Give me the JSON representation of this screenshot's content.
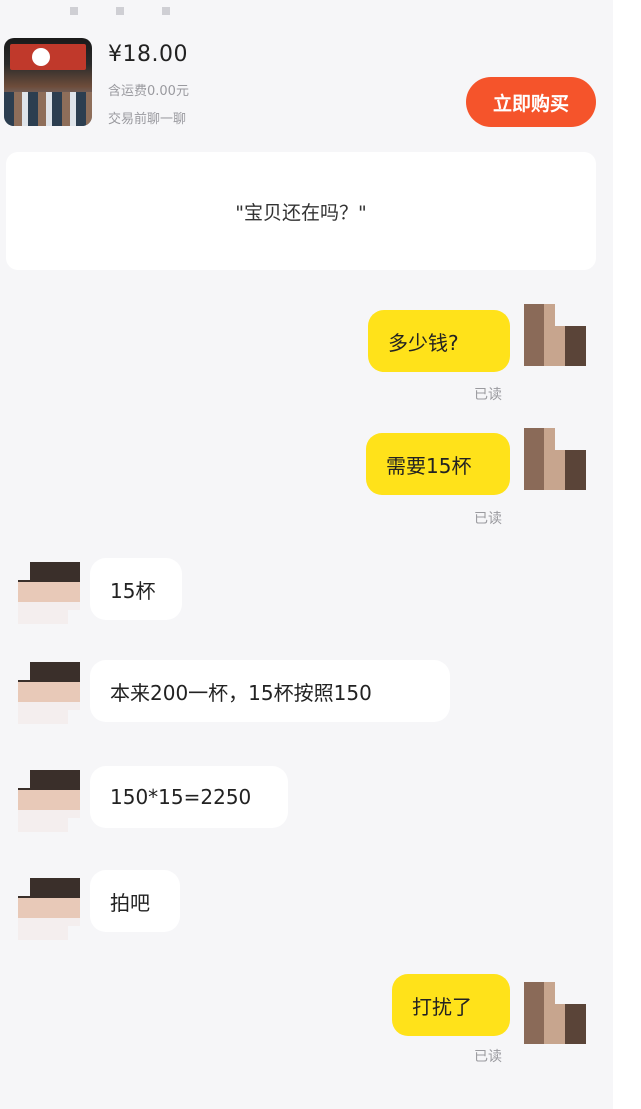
{
  "product": {
    "price": "¥18.00",
    "shipping": "含运费0.00元",
    "note": "交易前聊一聊",
    "buy_button": "立即购买"
  },
  "quote": "\"宝贝还在吗？\"",
  "messages": [
    {
      "sender": "me",
      "text": "多少钱?",
      "status": "已读"
    },
    {
      "sender": "me",
      "text": "需要15杯",
      "status": "已读"
    },
    {
      "sender": "them",
      "text": "15杯"
    },
    {
      "sender": "them",
      "text": "本来200一杯，15杯按照150"
    },
    {
      "sender": "them",
      "text": "150*15=2250"
    },
    {
      "sender": "them",
      "text": "拍吧"
    },
    {
      "sender": "me",
      "text": "打扰了",
      "status": "已读"
    }
  ]
}
